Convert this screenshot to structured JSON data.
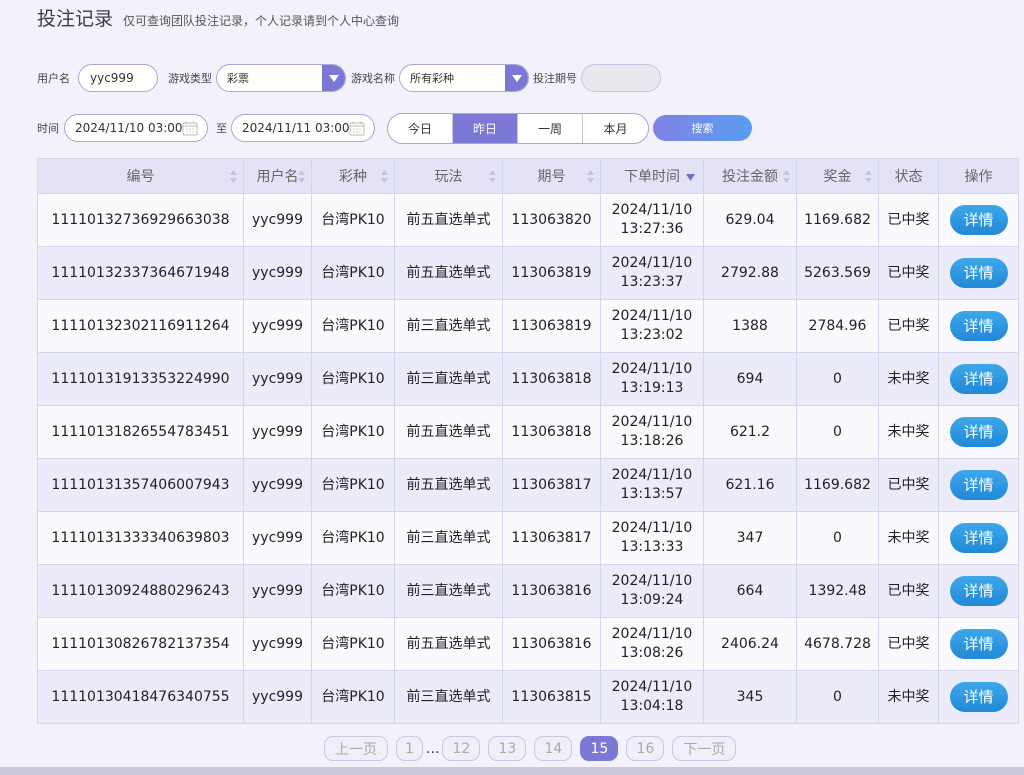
{
  "header": {
    "title": "投注记录",
    "subtitle": "仅可查询团队投注记录，个人记录请到个人中心查询"
  },
  "filters": {
    "username_label": "用户名",
    "username_value": "yyc999",
    "game_type_label": "游戏类型",
    "game_type_value": "彩票",
    "game_name_label": "游戏名称",
    "game_name_value": "所有彩种",
    "period_label": "投注期号",
    "period_value": "",
    "time_label": "时间",
    "time_start": "2024/11/10 03:00",
    "to_label": "至",
    "time_end": "2024/11/11 03:00",
    "quick_ranges": [
      "今日",
      "昨日",
      "一周",
      "本月"
    ],
    "active_range": "昨日",
    "search_label": "搜索"
  },
  "table": {
    "headers": [
      "编号",
      "用户名",
      "彩种",
      "玩法",
      "期号",
      "下单时间",
      "投注金额",
      "奖金",
      "状态",
      "操作"
    ],
    "rows": [
      {
        "id": "11110132736929663038",
        "user": "yyc999",
        "lottery": "台湾PK10",
        "play": "前五直选单式",
        "period": "113063820",
        "date": "2024/11/10",
        "time": "13:27:36",
        "amount": "629.04",
        "prize": "1169.682",
        "status": "已中奖",
        "win": true,
        "action": "详情"
      },
      {
        "id": "11110132337364671948",
        "user": "yyc999",
        "lottery": "台湾PK10",
        "play": "前五直选单式",
        "period": "113063819",
        "date": "2024/11/10",
        "time": "13:23:37",
        "amount": "2792.88",
        "prize": "5263.569",
        "status": "已中奖",
        "win": true,
        "action": "详情"
      },
      {
        "id": "11110132302116911264",
        "user": "yyc999",
        "lottery": "台湾PK10",
        "play": "前三直选单式",
        "period": "113063819",
        "date": "2024/11/10",
        "time": "13:23:02",
        "amount": "1388",
        "prize": "2784.96",
        "status": "已中奖",
        "win": true,
        "action": "详情"
      },
      {
        "id": "11110131913353224990",
        "user": "yyc999",
        "lottery": "台湾PK10",
        "play": "前三直选单式",
        "period": "113063818",
        "date": "2024/11/10",
        "time": "13:19:13",
        "amount": "694",
        "prize": "0",
        "status": "未中奖",
        "win": false,
        "action": "详情"
      },
      {
        "id": "11110131826554783451",
        "user": "yyc999",
        "lottery": "台湾PK10",
        "play": "前五直选单式",
        "period": "113063818",
        "date": "2024/11/10",
        "time": "13:18:26",
        "amount": "621.2",
        "prize": "0",
        "status": "未中奖",
        "win": false,
        "action": "详情"
      },
      {
        "id": "11110131357406007943",
        "user": "yyc999",
        "lottery": "台湾PK10",
        "play": "前五直选单式",
        "period": "113063817",
        "date": "2024/11/10",
        "time": "13:13:57",
        "amount": "621.16",
        "prize": "1169.682",
        "status": "已中奖",
        "win": true,
        "action": "详情"
      },
      {
        "id": "11110131333340639803",
        "user": "yyc999",
        "lottery": "台湾PK10",
        "play": "前三直选单式",
        "period": "113063817",
        "date": "2024/11/10",
        "time": "13:13:33",
        "amount": "347",
        "prize": "0",
        "status": "未中奖",
        "win": false,
        "action": "详情"
      },
      {
        "id": "11110130924880296243",
        "user": "yyc999",
        "lottery": "台湾PK10",
        "play": "前三直选单式",
        "period": "113063816",
        "date": "2024/11/10",
        "time": "13:09:24",
        "amount": "664",
        "prize": "1392.48",
        "status": "已中奖",
        "win": true,
        "action": "详情"
      },
      {
        "id": "11110130826782137354",
        "user": "yyc999",
        "lottery": "台湾PK10",
        "play": "前五直选单式",
        "period": "113063816",
        "date": "2024/11/10",
        "time": "13:08:26",
        "amount": "2406.24",
        "prize": "4678.728",
        "status": "已中奖",
        "win": true,
        "action": "详情"
      },
      {
        "id": "11110130418476340755",
        "user": "yyc999",
        "lottery": "台湾PK10",
        "play": "前三直选单式",
        "period": "113063815",
        "date": "2024/11/10",
        "time": "13:04:18",
        "amount": "345",
        "prize": "0",
        "status": "未中奖",
        "win": false,
        "action": "详情"
      }
    ]
  },
  "pagination": {
    "prev_label": "上一页",
    "first_page": "1",
    "ellipsis": "...",
    "pages": [
      "12",
      "13",
      "14",
      "15",
      "16"
    ],
    "current_page": "15",
    "next_label": "下一页"
  },
  "colors": {
    "accent": "#7b79d5",
    "win": "#e0584c",
    "detail_button": "#2188d6"
  }
}
